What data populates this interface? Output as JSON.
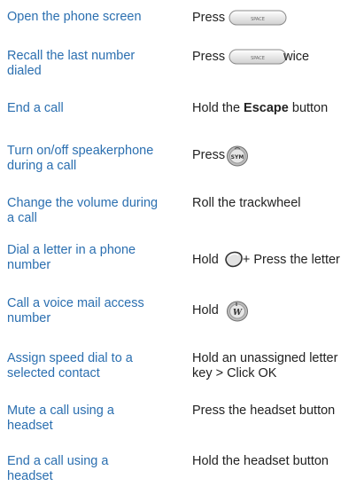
{
  "colors": {
    "task_text": "#2b6fb0",
    "body_text": "#222222"
  },
  "rows": [
    {
      "task": "Open the phone screen",
      "press": "Press",
      "key_label": "SPACE"
    },
    {
      "task": "Recall the last number dialed",
      "press": "Press",
      "key_label": "SPACE",
      "suffix": "wice"
    },
    {
      "task": "End a call",
      "hold": "Hold the",
      "bold": "Escape",
      "after": "button"
    },
    {
      "task": "Turn on/off speakerphone during a call",
      "press": "Press",
      "key_label": "SYM"
    },
    {
      "task": "Change the volume during a call",
      "instruction": "Roll the trackwheel"
    },
    {
      "task": "Dial a letter in a phone number",
      "hold": "Hold",
      "after": "+ Press the letter"
    },
    {
      "task": "Call a voice mail access number",
      "hold": "Hold",
      "key_label": "W"
    },
    {
      "task": "Assign speed dial to a selected contact",
      "instruction": "Hold an unassigned letter key > Click OK"
    },
    {
      "task": "Mute a call using a headset",
      "instruction": "Press the headset button"
    },
    {
      "task": "End a call using a headset",
      "instruction": "Hold the headset button"
    }
  ],
  "icons": {
    "space_key": "space-key-icon",
    "sym_key": "sym-key-icon",
    "alt_key": "alt-key-icon",
    "w_key": "w-key-icon"
  }
}
